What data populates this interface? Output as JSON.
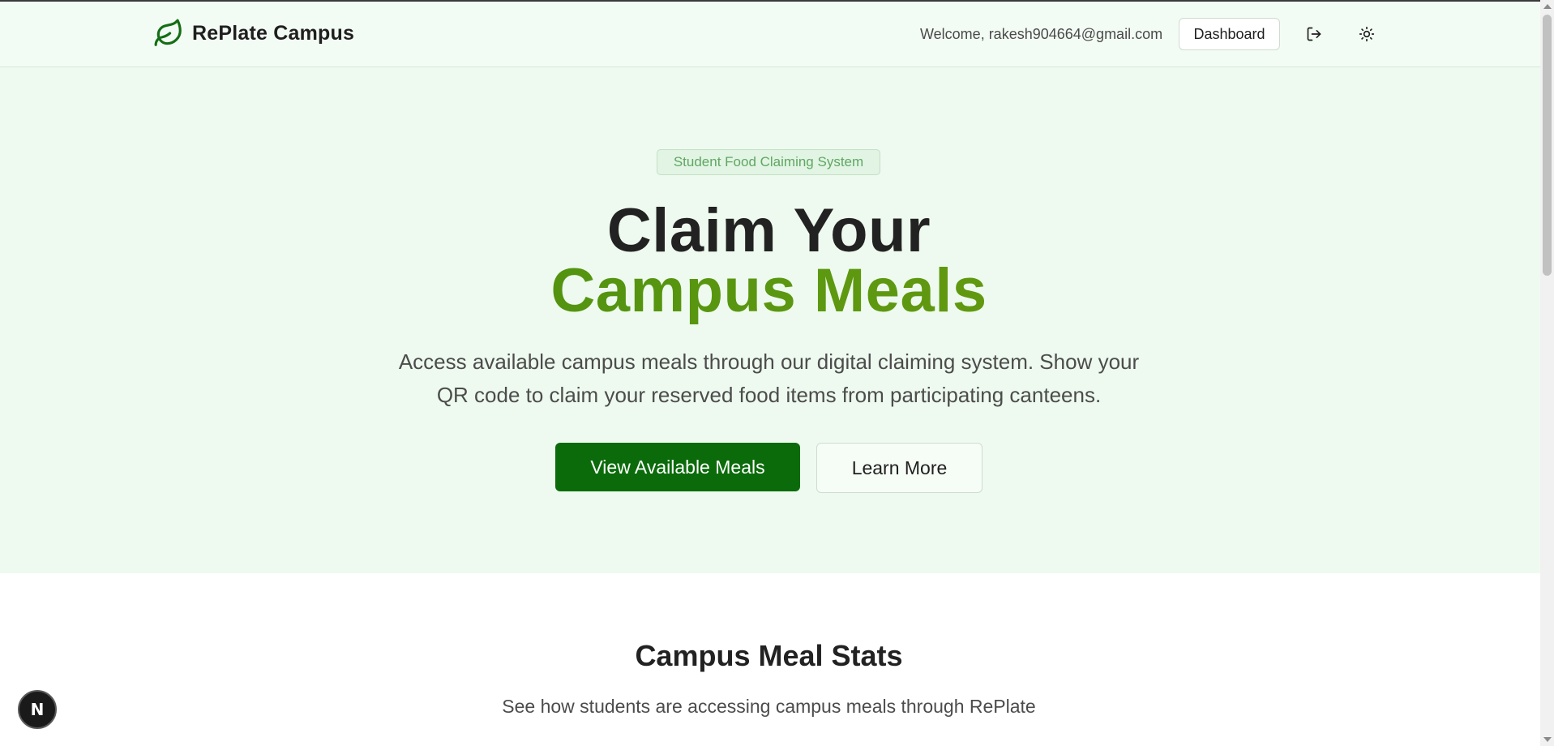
{
  "header": {
    "brand_name": "RePlate Campus",
    "welcome_text": "Welcome, rakesh904664@gmail.com",
    "dashboard_label": "Dashboard"
  },
  "hero": {
    "badge": "Student Food Claiming System",
    "title_line1": "Claim Your",
    "title_line2": "Campus Meals",
    "description": "Access available campus meals through our digital claiming system. Show your QR code to claim your reserved food items from participating canteens.",
    "primary_button": "View Available Meals",
    "secondary_button": "Learn More"
  },
  "stats": {
    "title": "Campus Meal Stats",
    "subtitle": "See how students are accessing campus meals through RePlate"
  },
  "floating_badge": "N",
  "icons": {
    "logo": "leaf-icon",
    "logout": "log-out-icon",
    "theme": "sun-icon"
  },
  "colors": {
    "brand_green": "#0b6b0b",
    "accent_gradient_start": "#3f8a10",
    "accent_gradient_end": "#6f9c12",
    "hero_background": "#eefaef"
  }
}
